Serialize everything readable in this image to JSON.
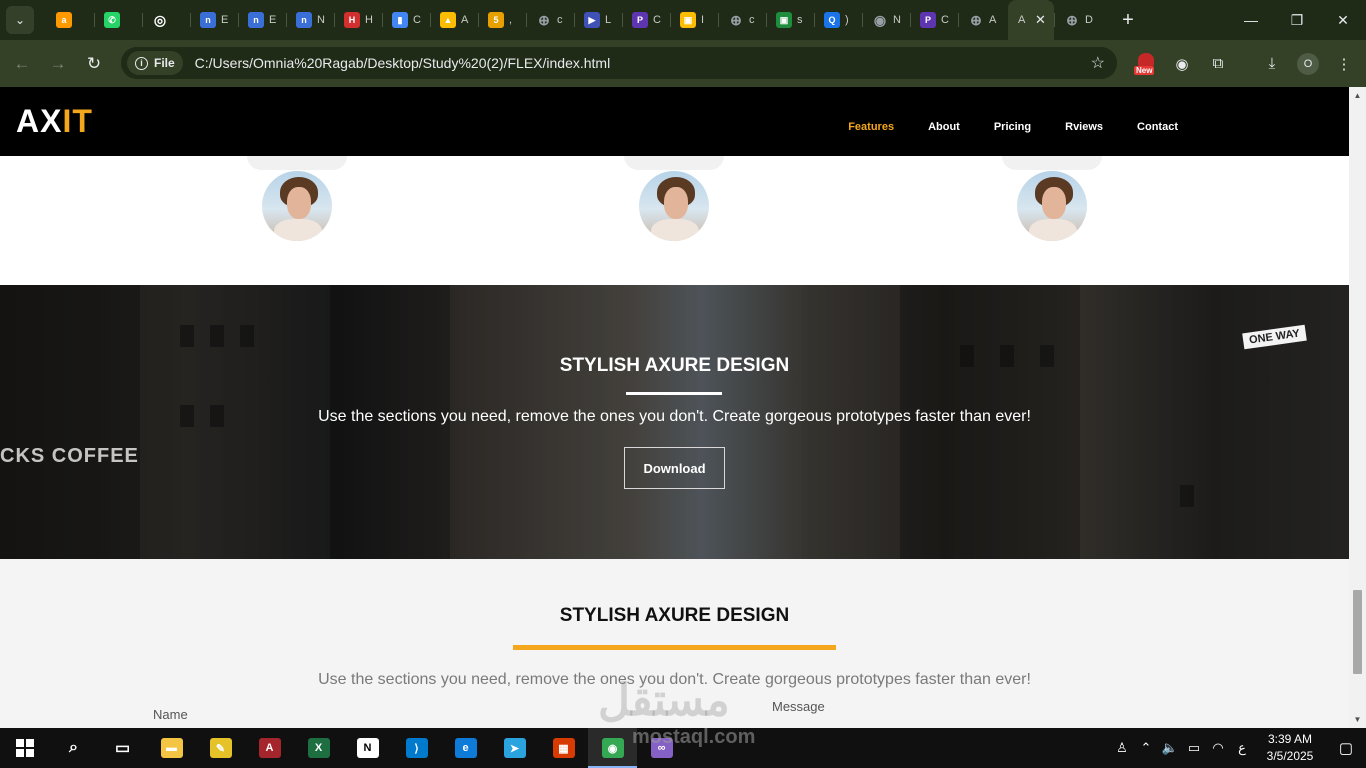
{
  "browser": {
    "tabs": [
      {
        "icon": "amazon-icon",
        "color": "#ff9900",
        "title": "",
        "glyph": "a"
      },
      {
        "icon": "whatsapp-icon",
        "color": "#25d366",
        "title": "",
        "glyph": "✆"
      },
      {
        "icon": "chatgpt-icon",
        "color": "#ffffff",
        "title": "",
        "glyph": "◎"
      },
      {
        "icon": "notion-n-icon",
        "color": "#3b6fd8",
        "title": "E",
        "glyph": "n"
      },
      {
        "icon": "notion-n-icon",
        "color": "#3b6fd8",
        "title": "E",
        "glyph": "n"
      },
      {
        "icon": "notion-n-icon",
        "color": "#3b6fd8",
        "title": "N",
        "glyph": "n"
      },
      {
        "icon": "hsu-icon",
        "color": "#d32f2f",
        "title": "H",
        "glyph": "H"
      },
      {
        "icon": "chart-icon",
        "color": "#4285f4",
        "title": "C",
        "glyph": "▮"
      },
      {
        "icon": "drive-icon",
        "color": "#fbbc04",
        "title": "A",
        "glyph": "▲"
      },
      {
        "icon": "html5-icon",
        "color": "#e8a000",
        "title": ",",
        "glyph": "5"
      },
      {
        "icon": "globe-icon",
        "color": "#9aa0a6",
        "title": "c",
        "glyph": "⊕"
      },
      {
        "icon": "video-icon",
        "color": "#3f51b5",
        "title": "L",
        "glyph": "▶"
      },
      {
        "icon": "p-icon",
        "color": "#5e35b1",
        "title": "C",
        "glyph": "P"
      },
      {
        "icon": "slides-icon",
        "color": "#fbbc04",
        "title": "I",
        "glyph": "▣"
      },
      {
        "icon": "globe-icon",
        "color": "#9aa0a6",
        "title": "c",
        "glyph": "⊕"
      },
      {
        "icon": "classroom-icon",
        "color": "#1e8e3e",
        "title": "s",
        "glyph": "▣"
      },
      {
        "icon": "quiz-icon",
        "color": "#1a73e8",
        "title": ")",
        "glyph": "Q"
      },
      {
        "icon": "chrome-icon",
        "color": "#9aa0a6",
        "title": "N",
        "glyph": "◉"
      },
      {
        "icon": "p-icon",
        "color": "#5e35b1",
        "title": "C",
        "glyph": "P"
      },
      {
        "icon": "globe-icon",
        "color": "#9aa0a6",
        "title": "A",
        "glyph": "⊕"
      }
    ],
    "active_tab": {
      "title": "A",
      "close": "✕"
    },
    "last_tab": {
      "title": "D"
    },
    "new_tab": "+",
    "window_controls": {
      "minimize": "—",
      "restore": "❐",
      "close": "✕"
    },
    "address": {
      "scheme_chip": "File",
      "url": "C:/Users/Omnia%20Ragab/Desktop/Study%20(2)/FLEX/index.html"
    },
    "extensions": {
      "new_badge": "New",
      "profile_initial": "O"
    }
  },
  "site": {
    "logo_main": "AX",
    "logo_accent": "IT",
    "nav": [
      {
        "label": "Features",
        "active": true
      },
      {
        "label": "About",
        "active": false
      },
      {
        "label": "Pricing",
        "active": false
      },
      {
        "label": "Rviews",
        "active": false
      },
      {
        "label": "Contact",
        "active": false
      }
    ],
    "hero": {
      "title": "STYLISH AXURE DESIGN",
      "text": "Use the sections you need, remove the ones you don't. Create gorgeous prototypes faster than ever!",
      "button": "Download",
      "sign_coffee": "CKS COFFEE",
      "sign_one_way": "ONE WAY"
    },
    "contact": {
      "title": "STYLISH AXURE DESIGN",
      "text": "Use the sections you need, remove the ones you don't. Create gorgeous prototypes faster than ever!",
      "name_label": "Name",
      "message_label": "Message"
    },
    "accent_color": "#f4a61d"
  },
  "watermark": {
    "arabic": "مستقل",
    "latin": "mostaql.com"
  },
  "taskbar": {
    "apps": [
      {
        "icon": "file-explorer-icon",
        "color": "#f4c542",
        "glyph": "▬"
      },
      {
        "icon": "paint-icon",
        "color": "#e6c229",
        "glyph": "✎"
      },
      {
        "icon": "access-icon",
        "color": "#a4262c",
        "glyph": "A"
      },
      {
        "icon": "excel-icon",
        "color": "#1d6f42",
        "glyph": "X"
      },
      {
        "icon": "notion-icon",
        "color": "#ffffff",
        "glyph": "N"
      },
      {
        "icon": "vscode-icon",
        "color": "#007acc",
        "glyph": "⟩"
      },
      {
        "icon": "edge-icon",
        "color": "#0f7bd8",
        "glyph": "e"
      },
      {
        "icon": "telegram-icon",
        "color": "#2aa3df",
        "glyph": "➤"
      },
      {
        "icon": "app-grid-icon",
        "color": "#d83b01",
        "glyph": "▦"
      },
      {
        "icon": "chrome-icon",
        "color": "#34a853",
        "glyph": "◉",
        "active": true
      },
      {
        "icon": "visual-studio-icon",
        "color": "#8661c5",
        "glyph": "∞"
      }
    ],
    "tray": {
      "lang": "ع",
      "time": "3:39 AM",
      "date": "3/5/2025"
    }
  }
}
